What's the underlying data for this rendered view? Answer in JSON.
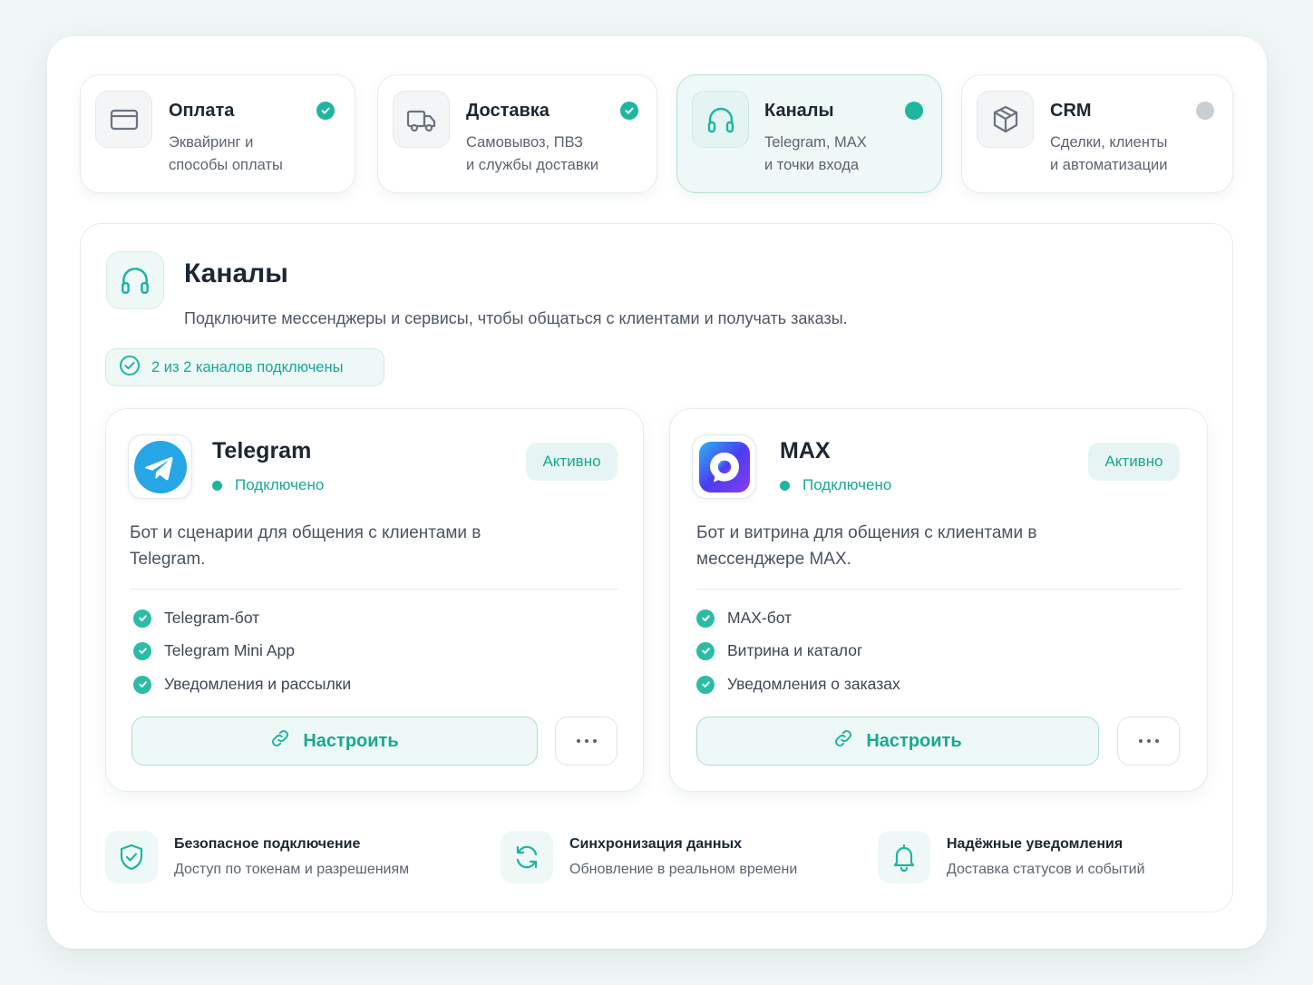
{
  "steps": [
    {
      "title": "Оплата",
      "subtitle": "Эквайринг и\nспособы оплаты",
      "status": "done",
      "icon": "card-icon"
    },
    {
      "title": "Доставка",
      "subtitle": "Самовывоз, ПВЗ\nи службы доставки",
      "status": "done",
      "icon": "truck-icon"
    },
    {
      "title": "Каналы",
      "subtitle": "Telegram, MAX\nи точки входа",
      "status": "current",
      "icon": "headphones-icon"
    },
    {
      "title": "CRM",
      "subtitle": "Сделки, клиенты\nи автоматизации",
      "status": "pending",
      "icon": "box-icon"
    }
  ],
  "section": {
    "title": "Каналы",
    "description": "Подключите мессенджеры и сервисы, чтобы общаться с клиентами и получать заказы.",
    "badge": "2 из 2 каналов подключены"
  },
  "channels": [
    {
      "name": "Telegram",
      "connection": "Подключено",
      "status_pill": "Активно",
      "description": "Бот и сценарии для общения с клиентами в Telegram.",
      "features": [
        "Telegram-бот",
        "Telegram Mini App",
        "Уведомления и рассылки"
      ],
      "configure_label": "Настроить",
      "icon": "telegram-logo-icon"
    },
    {
      "name": "MAX",
      "connection": "Подключено",
      "status_pill": "Активно",
      "description": "Бот и витрина для общения с клиентами в мессенджере MAX.",
      "features": [
        "MAX-бот",
        "Витрина и каталог",
        "Уведомления о заказах"
      ],
      "configure_label": "Настроить",
      "icon": "max-logo-icon"
    }
  ],
  "footer": [
    {
      "title": "Безопасное подключение",
      "subtitle": "Доступ по токенам и разрешениям",
      "icon": "shield-check-icon"
    },
    {
      "title": "Синхронизация данных",
      "subtitle": "Обновление в реальном времени",
      "icon": "sync-icon"
    },
    {
      "title": "Надёжные уведомления",
      "subtitle": "Доставка статусов и событий",
      "icon": "bell-icon"
    }
  ],
  "colors": {
    "accent": "#1fb5a0",
    "accent_light": "#eef8f7",
    "pending": "#c9ced3",
    "telegram": "#27a6e5",
    "max": "#4b3df0"
  }
}
